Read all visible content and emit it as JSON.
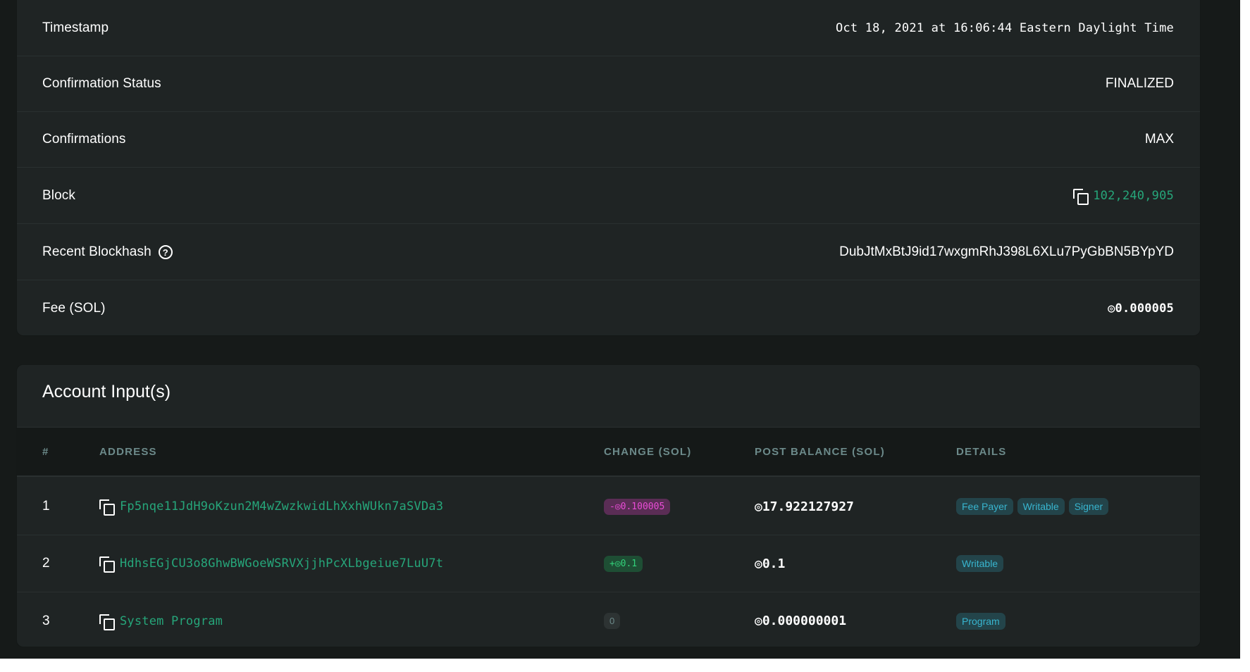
{
  "details": {
    "rows": [
      {
        "label": "Timestamp",
        "value": "Oct 18, 2021 at 16:06:44 Eastern Daylight Time"
      },
      {
        "label": "Confirmation Status",
        "value": "FINALIZED"
      },
      {
        "label": "Confirmations",
        "value": "MAX"
      },
      {
        "label": "Block",
        "value": "102,240,905"
      },
      {
        "label": "Recent Blockhash",
        "value": "DubJtMxBtJ9id17wxgmRhJ398L6XLu7PyGbBN5BYpYD"
      },
      {
        "label": "Fee (SOL)",
        "value": "◎0.000005"
      }
    ],
    "help_glyph": "?"
  },
  "accounts": {
    "title": "Account Input(s)",
    "columns": [
      "#",
      "Address",
      "Change (SOL)",
      "Post Balance (SOL)",
      "Details"
    ],
    "rows": [
      {
        "index": "1",
        "address": "Fp5nqe11JdH9oKzun2M4wZwzkwidLhXxhWUkn7aSVDa3",
        "change": "-◎0.100005",
        "post_balance": "◎17.922127927",
        "details": [
          "Fee Payer",
          "Writable",
          "Signer"
        ]
      },
      {
        "index": "2",
        "address": "HdhsEGjCU3o8GhwBWGoeWSRVXjjhPcXLbgeiue7LuU7t",
        "change": "+◎0.1",
        "post_balance": "◎0.1",
        "details": [
          "Writable"
        ]
      },
      {
        "index": "3",
        "address": "System Program",
        "change": "0",
        "post_balance": "◎0.000000001",
        "details": [
          "Program"
        ]
      }
    ]
  },
  "colors": {
    "link": "#26a67a",
    "negative": "#e94cd6",
    "positive": "#33d17a",
    "badge": "#38b5cf"
  }
}
